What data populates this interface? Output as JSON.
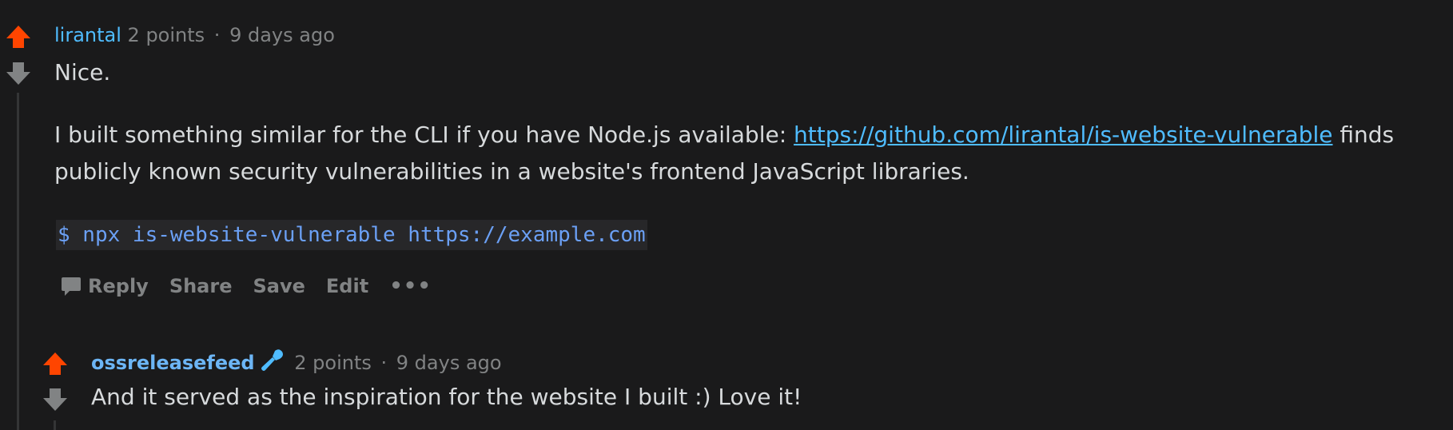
{
  "comments": [
    {
      "author": "lirantal",
      "points": "2 points",
      "separator": "·",
      "time": "9 days ago",
      "line1": "Nice.",
      "para_prefix": "I built something similar for the CLI if you have Node.js available: ",
      "link_text": "https://github.com/lirantal/is-website-vulnerable",
      "para_suffix": " finds",
      "para_line2": "publicly known security vulnerabilities in a website's frontend JavaScript libraries.",
      "code": "$ npx is-website-vulnerable https://example.com",
      "actions": {
        "reply": "Reply",
        "share": "Share",
        "save": "Save",
        "edit": "Edit",
        "more": "•••"
      }
    },
    {
      "author": "ossreleasefeed",
      "author_icon": "microphone-icon",
      "points": "2 points",
      "separator": "·",
      "time": "9 days ago",
      "text": "And it served as the inspiration for the website I built :) Love it!"
    }
  ],
  "colors": {
    "background": "#1a1a1b",
    "upvote": "#ff4500",
    "downvote": "#818384",
    "link": "#4fbcff",
    "code": "#6ba0f5"
  }
}
